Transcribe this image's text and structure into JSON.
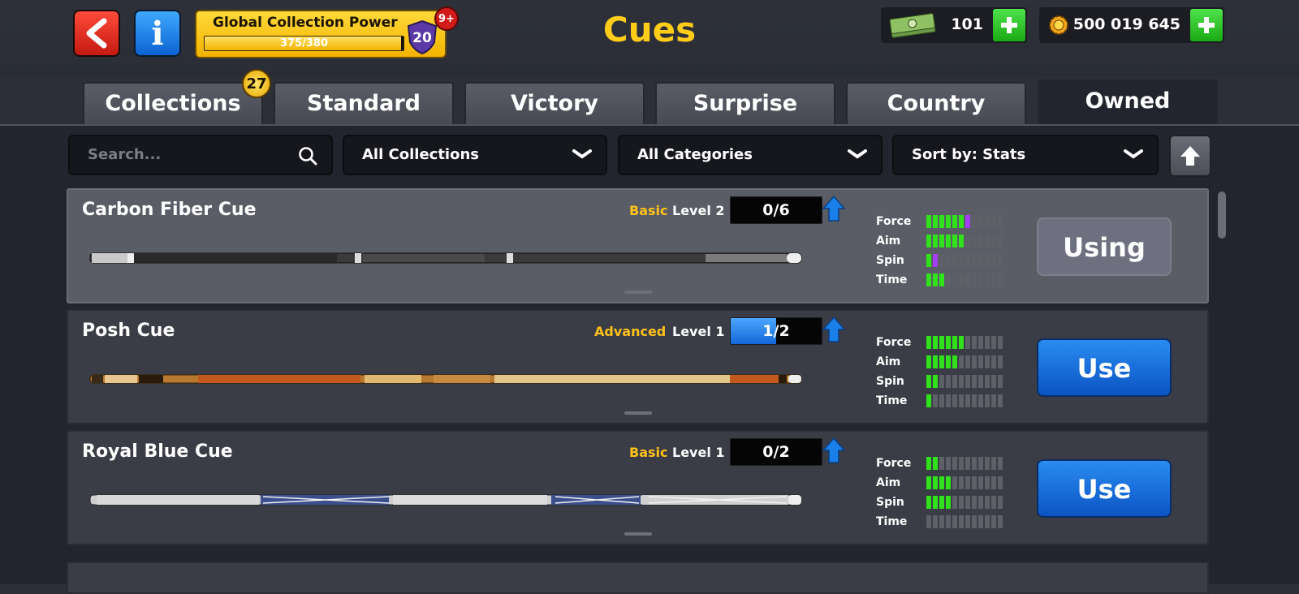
{
  "header": {
    "title": "Cues",
    "back_icon": "chevron-left-icon",
    "info_label": "i",
    "global_collection_power": {
      "label": "Global Collection Power",
      "progress_text": "375/380",
      "progress_fraction": 0.987,
      "level": "20",
      "notification_badge": "9+"
    },
    "cash": {
      "icon": "cash-stack-icon",
      "value": "101"
    },
    "coins": {
      "icon": "coin-gear-icon",
      "value": "500 019 645"
    }
  },
  "tabs": [
    {
      "label": "Collections",
      "badge": "27",
      "active": false
    },
    {
      "label": "Standard",
      "active": false
    },
    {
      "label": "Victory",
      "active": false
    },
    {
      "label": "Surprise",
      "active": false
    },
    {
      "label": "Country",
      "active": false
    },
    {
      "label": "Owned",
      "active": true
    }
  ],
  "filters": {
    "search_placeholder": "Search...",
    "collections": "All Collections",
    "categories": "All Categories",
    "sort": "Sort by: Stats"
  },
  "stat_labels": [
    "Force",
    "Aim",
    "Spin",
    "Time"
  ],
  "cues": [
    {
      "name": "Carbon Fiber Cue",
      "category": "Basic",
      "level": "Level 2",
      "progress_text": "0/6",
      "progress_fraction": 0,
      "stats": {
        "force": [
          6,
          1
        ],
        "aim": [
          6,
          0
        ],
        "spin": [
          1,
          1
        ],
        "time": [
          3,
          0
        ]
      },
      "action": "Using",
      "selected": true
    },
    {
      "name": "Posh Cue",
      "category": "Advanced",
      "level": "Level 1",
      "progress_text": "1/2",
      "progress_fraction": 0.5,
      "stats": {
        "force": [
          6,
          0
        ],
        "aim": [
          5,
          0
        ],
        "spin": [
          2,
          0
        ],
        "time": [
          1,
          0
        ]
      },
      "action": "Use",
      "selected": false
    },
    {
      "name": "Royal Blue Cue",
      "category": "Basic",
      "level": "Level 1",
      "progress_text": "0/2",
      "progress_fraction": 0,
      "stats": {
        "force": [
          2,
          0
        ],
        "aim": [
          4,
          0
        ],
        "spin": [
          4,
          0
        ],
        "time": [
          0,
          0
        ]
      },
      "action": "Use",
      "selected": false
    }
  ],
  "colors": {
    "gold": "#ffcc1a",
    "stat_green": "#30e11c",
    "stat_purple": "#a33ff0",
    "use_blue": "#1a6fe0"
  }
}
